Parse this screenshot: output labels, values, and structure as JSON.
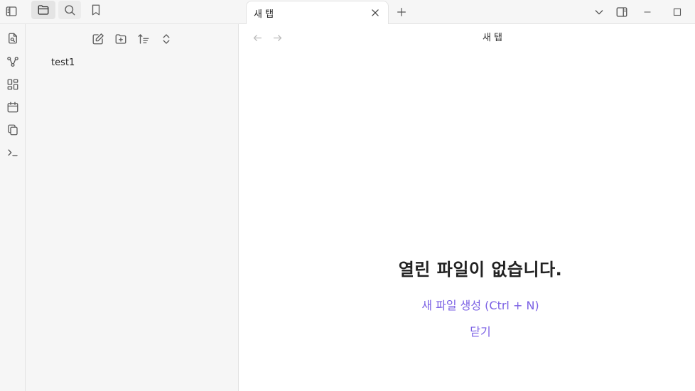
{
  "sidebar": {
    "top_tabs": [
      {
        "icon": "folder-icon",
        "active": true
      },
      {
        "icon": "search-icon",
        "active": false
      },
      {
        "icon": "bookmark-icon",
        "active": false
      }
    ],
    "nav_actions": [
      "new-note-icon",
      "new-folder-icon",
      "sort-icon",
      "collapse-expand-icon"
    ],
    "files": [
      {
        "name": "test1"
      }
    ]
  },
  "ribbon": {
    "icons": [
      "file-switcher-icon",
      "graph-icon",
      "canvas-icon",
      "calendar-icon",
      "templates-icon",
      "terminal-icon"
    ]
  },
  "tabs": [
    {
      "title": "새 탭"
    }
  ],
  "view": {
    "title": "새 탭"
  },
  "empty_state": {
    "title": "열린 파일이 없습니다.",
    "create_link": "새 파일 생성 (Ctrl + N)",
    "close_link": "닫기"
  },
  "colors": {
    "accent": "#7b61e4",
    "sidebar_bg": "#f6f6f6",
    "active_bg": "#e4e4e4"
  }
}
